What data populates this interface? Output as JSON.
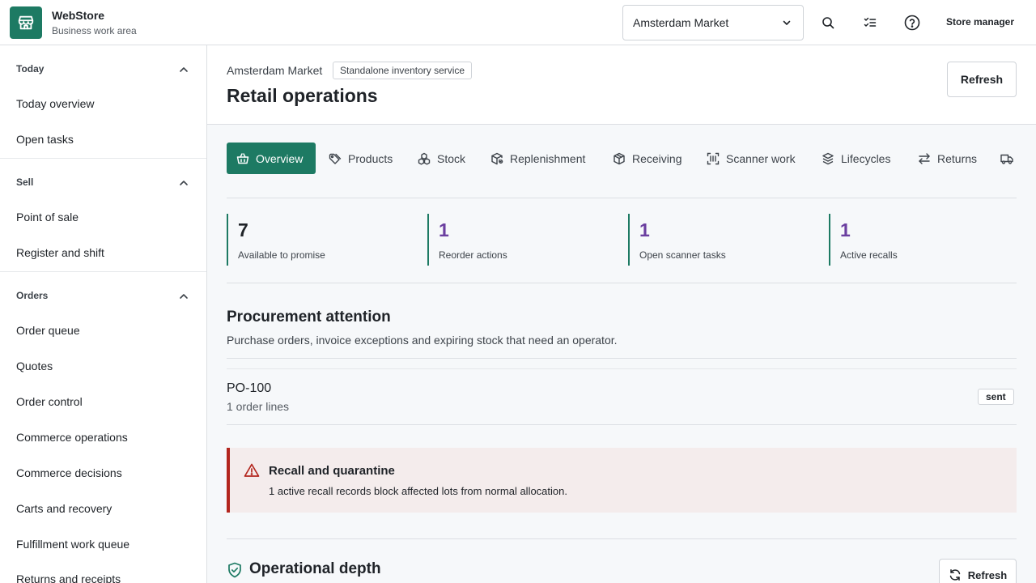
{
  "app": {
    "name": "WebStore",
    "subtitle": "Business work area",
    "brand_color": "#1d7a63"
  },
  "topbar": {
    "store_selected": "Amsterdam Market",
    "user_label": "Store manager",
    "icons": [
      "search-icon",
      "checklist-icon",
      "help-icon"
    ]
  },
  "sidebar": {
    "sections": [
      {
        "label": "Today",
        "items": [
          "Today overview",
          "Open tasks"
        ]
      },
      {
        "label": "Sell",
        "items": [
          "Point of sale",
          "Register and shift"
        ]
      },
      {
        "label": "Orders",
        "items": [
          "Order queue",
          "Quotes",
          "Order control",
          "Commerce operations",
          "Commerce decisions",
          "Carts and recovery",
          "Fulfillment work queue",
          "Returns and receipts"
        ]
      }
    ]
  },
  "header": {
    "breadcrumb": "Amsterdam Market",
    "service_badge": "Standalone inventory service",
    "title": "Retail operations",
    "refresh_label": "Refresh"
  },
  "tabs": [
    {
      "label": "Overview",
      "icon": "basket-icon",
      "active": true
    },
    {
      "label": "Products",
      "icon": "tag-icon"
    },
    {
      "label": "Stock",
      "icon": "boxes-icon"
    },
    {
      "label": "Replenishment",
      "icon": "package-refresh-icon"
    },
    {
      "label": "Receiving",
      "icon": "package-icon"
    },
    {
      "label": "Scanner work",
      "icon": "barcode-scan-icon"
    },
    {
      "label": "Lifecycles",
      "icon": "layers-icon"
    },
    {
      "label": "Returns",
      "icon": "swap-icon"
    },
    {
      "label": "",
      "icon": "truck-icon"
    }
  ],
  "kpis": [
    {
      "value": "7",
      "label": "Available to promise",
      "color": "#1f2328"
    },
    {
      "value": "1",
      "label": "Reorder actions",
      "color": "#6b3fa0"
    },
    {
      "value": "1",
      "label": "Open scanner tasks",
      "color": "#6b3fa0"
    },
    {
      "value": "1",
      "label": "Active recalls",
      "color": "#6b3fa0"
    }
  ],
  "procurement": {
    "title": "Procurement attention",
    "subtitle": "Purchase orders, invoice exceptions and expiring stock that need an operator.",
    "orders": [
      {
        "id": "PO-100",
        "lines": "1 order lines",
        "status": "sent"
      }
    ]
  },
  "alert": {
    "title": "Recall and quarantine",
    "description": "1 active recall records block affected lots from normal allocation.",
    "color": "#b3261e"
  },
  "depth": {
    "title": "Operational depth",
    "refresh_label": "Refresh"
  }
}
